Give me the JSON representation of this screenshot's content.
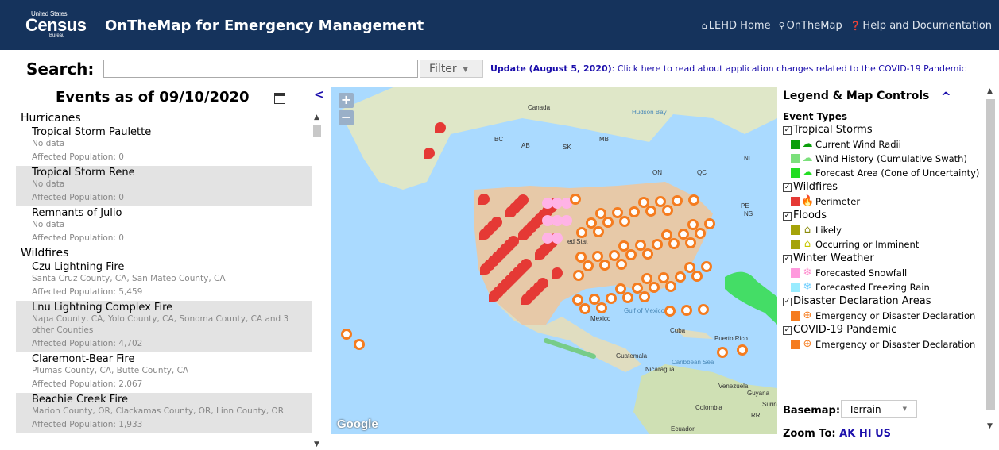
{
  "header": {
    "logo_small": "United States",
    "logo_big": "Census",
    "logo_bureau": "Bureau",
    "app_title": "OnTheMap for Emergency Management",
    "nav": [
      {
        "label": "LEHD Home",
        "icon": "home-icon"
      },
      {
        "label": "OnTheMap",
        "icon": "pin-icon"
      },
      {
        "label": "Help and Documentation",
        "icon": "help-icon"
      }
    ]
  },
  "search": {
    "label": "Search:",
    "value": "",
    "filter_label": "Filter",
    "update_prefix": "Update (August 5, 2020)",
    "update_text": ": Click here to read about application changes related to the COVID-19 Pandemic"
  },
  "events": {
    "heading": "Events as of 09/10/2020",
    "collapse_glyph": "<",
    "categories": [
      {
        "name": "Hurricanes",
        "items": [
          {
            "name": "Tropical Storm Paulette",
            "sub": "No data",
            "pop": "Affected Population: 0",
            "alt": false
          },
          {
            "name": "Tropical Storm Rene",
            "sub": "No data",
            "pop": "Affected Population: 0",
            "alt": true
          },
          {
            "name": "Remnants of Julio",
            "sub": "No data",
            "pop": "Affected Population: 0",
            "alt": false
          }
        ]
      },
      {
        "name": "Wildfires",
        "items": [
          {
            "name": "Czu Lightning Fire",
            "sub": "Santa Cruz County, CA, San Mateo County, CA",
            "pop": "Affected Population: 5,459",
            "alt": false
          },
          {
            "name": "Lnu Lightning Complex Fire",
            "sub": "Napa County, CA, Yolo County, CA, Sonoma County, CA and 3 other Counties",
            "pop": "Affected Population: 4,702",
            "alt": true
          },
          {
            "name": "Claremont-Bear Fire",
            "sub": "Plumas County, CA, Butte County, CA",
            "pop": "Affected Population: 2,067",
            "alt": false
          },
          {
            "name": "Beachie Creek Fire",
            "sub": "Marion County, OR, Clackamas County, OR, Linn County, OR",
            "pop": "Affected Population: 1,933",
            "alt": true
          }
        ]
      }
    ]
  },
  "map": {
    "zoom_in": "+",
    "zoom_out": "−",
    "google_label": "Google",
    "labels": [
      {
        "text": "Canada",
        "water": false
      },
      {
        "text": "Hudson Bay",
        "water": true
      },
      {
        "text": "AB",
        "water": false
      },
      {
        "text": "BC",
        "water": false
      },
      {
        "text": "SK",
        "water": false
      },
      {
        "text": "MB",
        "water": false
      },
      {
        "text": "ON",
        "water": false
      },
      {
        "text": "QC",
        "water": false
      },
      {
        "text": "NL",
        "water": false
      },
      {
        "text": "PE",
        "water": false
      },
      {
        "text": "NS",
        "water": false
      },
      {
        "text": "ed Stat",
        "water": false
      },
      {
        "text": "Gulf of Mexico",
        "water": true
      },
      {
        "text": "Mexico",
        "water": false
      },
      {
        "text": "Cuba",
        "water": false
      },
      {
        "text": "Puerto Rico",
        "water": false
      },
      {
        "text": "Guatemala",
        "water": false
      },
      {
        "text": "Caribbean Sea",
        "water": true
      },
      {
        "text": "Nicaragua",
        "water": false
      },
      {
        "text": "Venezuela",
        "water": false
      },
      {
        "text": "Colombia",
        "water": false
      },
      {
        "text": "Guyana",
        "water": false
      },
      {
        "text": "Surina",
        "water": false
      },
      {
        "text": "RR",
        "water": false
      },
      {
        "text": "Ecuador",
        "water": false
      }
    ]
  },
  "legend": {
    "title": "Legend & Map Controls",
    "collapse_glyph": "^",
    "event_types_label": "Event Types",
    "groups": [
      {
        "label": "Tropical Storms",
        "checked": true,
        "items": [
          {
            "label": "Current Wind Radii",
            "color": "#0a9e0a",
            "icon": "storm-icon",
            "icon_color": "#0a9e0a"
          },
          {
            "label": "Wind History (Cumulative Swath)",
            "color": "#7be07b",
            "icon": "storm-icon",
            "icon_color": "#7be07b"
          },
          {
            "label": "Forecast Area (Cone of Uncertainty)",
            "color": "#22dd22",
            "icon": "storm-icon",
            "icon_color": "#22dd22"
          }
        ]
      },
      {
        "label": "Wildfires",
        "checked": true,
        "items": [
          {
            "label": "Perimeter",
            "color": "#e53935",
            "icon": "flame-icon",
            "icon_color": "#e53935"
          }
        ]
      },
      {
        "label": "Floods",
        "checked": true,
        "items": [
          {
            "label": "Likely",
            "color": "#a5a30a",
            "icon": "flood-icon",
            "icon_color": "#8a8a0a"
          },
          {
            "label": "Occurring or Imminent",
            "color": "#a5a30a",
            "icon": "flood-icon",
            "icon_color": "#c7c700"
          }
        ]
      },
      {
        "label": "Winter Weather",
        "checked": true,
        "items": [
          {
            "label": "Forecasted Snowfall",
            "color": "#ff99dd",
            "icon": "snowflake-icon",
            "icon_color": "#ff88cc"
          },
          {
            "label": "Forecasted Freezing Rain",
            "color": "#99ecff",
            "icon": "snowflake-icon",
            "icon_color": "#66ccff"
          }
        ]
      },
      {
        "label": "Disaster Declaration Areas",
        "checked": true,
        "items": [
          {
            "label": "Emergency or Disaster Declaration",
            "color": "#f57c1f",
            "icon": "lifebuoy-icon",
            "icon_color": "#f57c1f"
          }
        ]
      },
      {
        "label": "COVID-19 Pandemic",
        "checked": true,
        "items": [
          {
            "label": "Emergency or Disaster Declaration",
            "color": "#f57c1f",
            "icon": "lifebuoy-icon",
            "icon_color": "#f57c1f"
          }
        ]
      }
    ],
    "basemap_label": "Basemap:",
    "basemap_value": "Terrain",
    "zoom_to_label": "Zoom To:",
    "zoom_to_links": "AK HI US"
  },
  "colors": {
    "header_bg": "#15335c",
    "link": "#1a0dab",
    "map_water": "#aadaff",
    "land": "#e8e4d0",
    "wildfire": "#e53935",
    "declaration": "#f57c1f"
  }
}
